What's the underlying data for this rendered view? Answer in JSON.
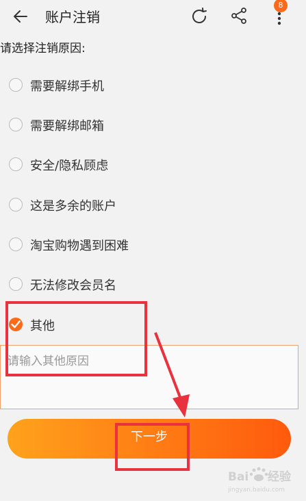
{
  "header": {
    "title": "账户注销",
    "badge_count": "8"
  },
  "prompt": "请选择注销原因:",
  "options": [
    {
      "label": "需要解绑手机",
      "checked": false
    },
    {
      "label": "需要解绑邮箱",
      "checked": false
    },
    {
      "label": "安全/隐私顾虑",
      "checked": false
    },
    {
      "label": "这是多余的账户",
      "checked": false
    },
    {
      "label": "淘宝购物遇到困难",
      "checked": false
    },
    {
      "label": "无法修改会员名",
      "checked": false
    },
    {
      "label": "其他",
      "checked": true
    }
  ],
  "other_reason": {
    "placeholder": "请输入其他原因",
    "value": ""
  },
  "next_button": "下一步",
  "watermark": "Baidu经验",
  "colors": {
    "accent": "#ff6a1a",
    "annotation": "#e8323d",
    "button_gradient_start": "#ffa21c",
    "button_gradient_end": "#ff5a0d"
  }
}
